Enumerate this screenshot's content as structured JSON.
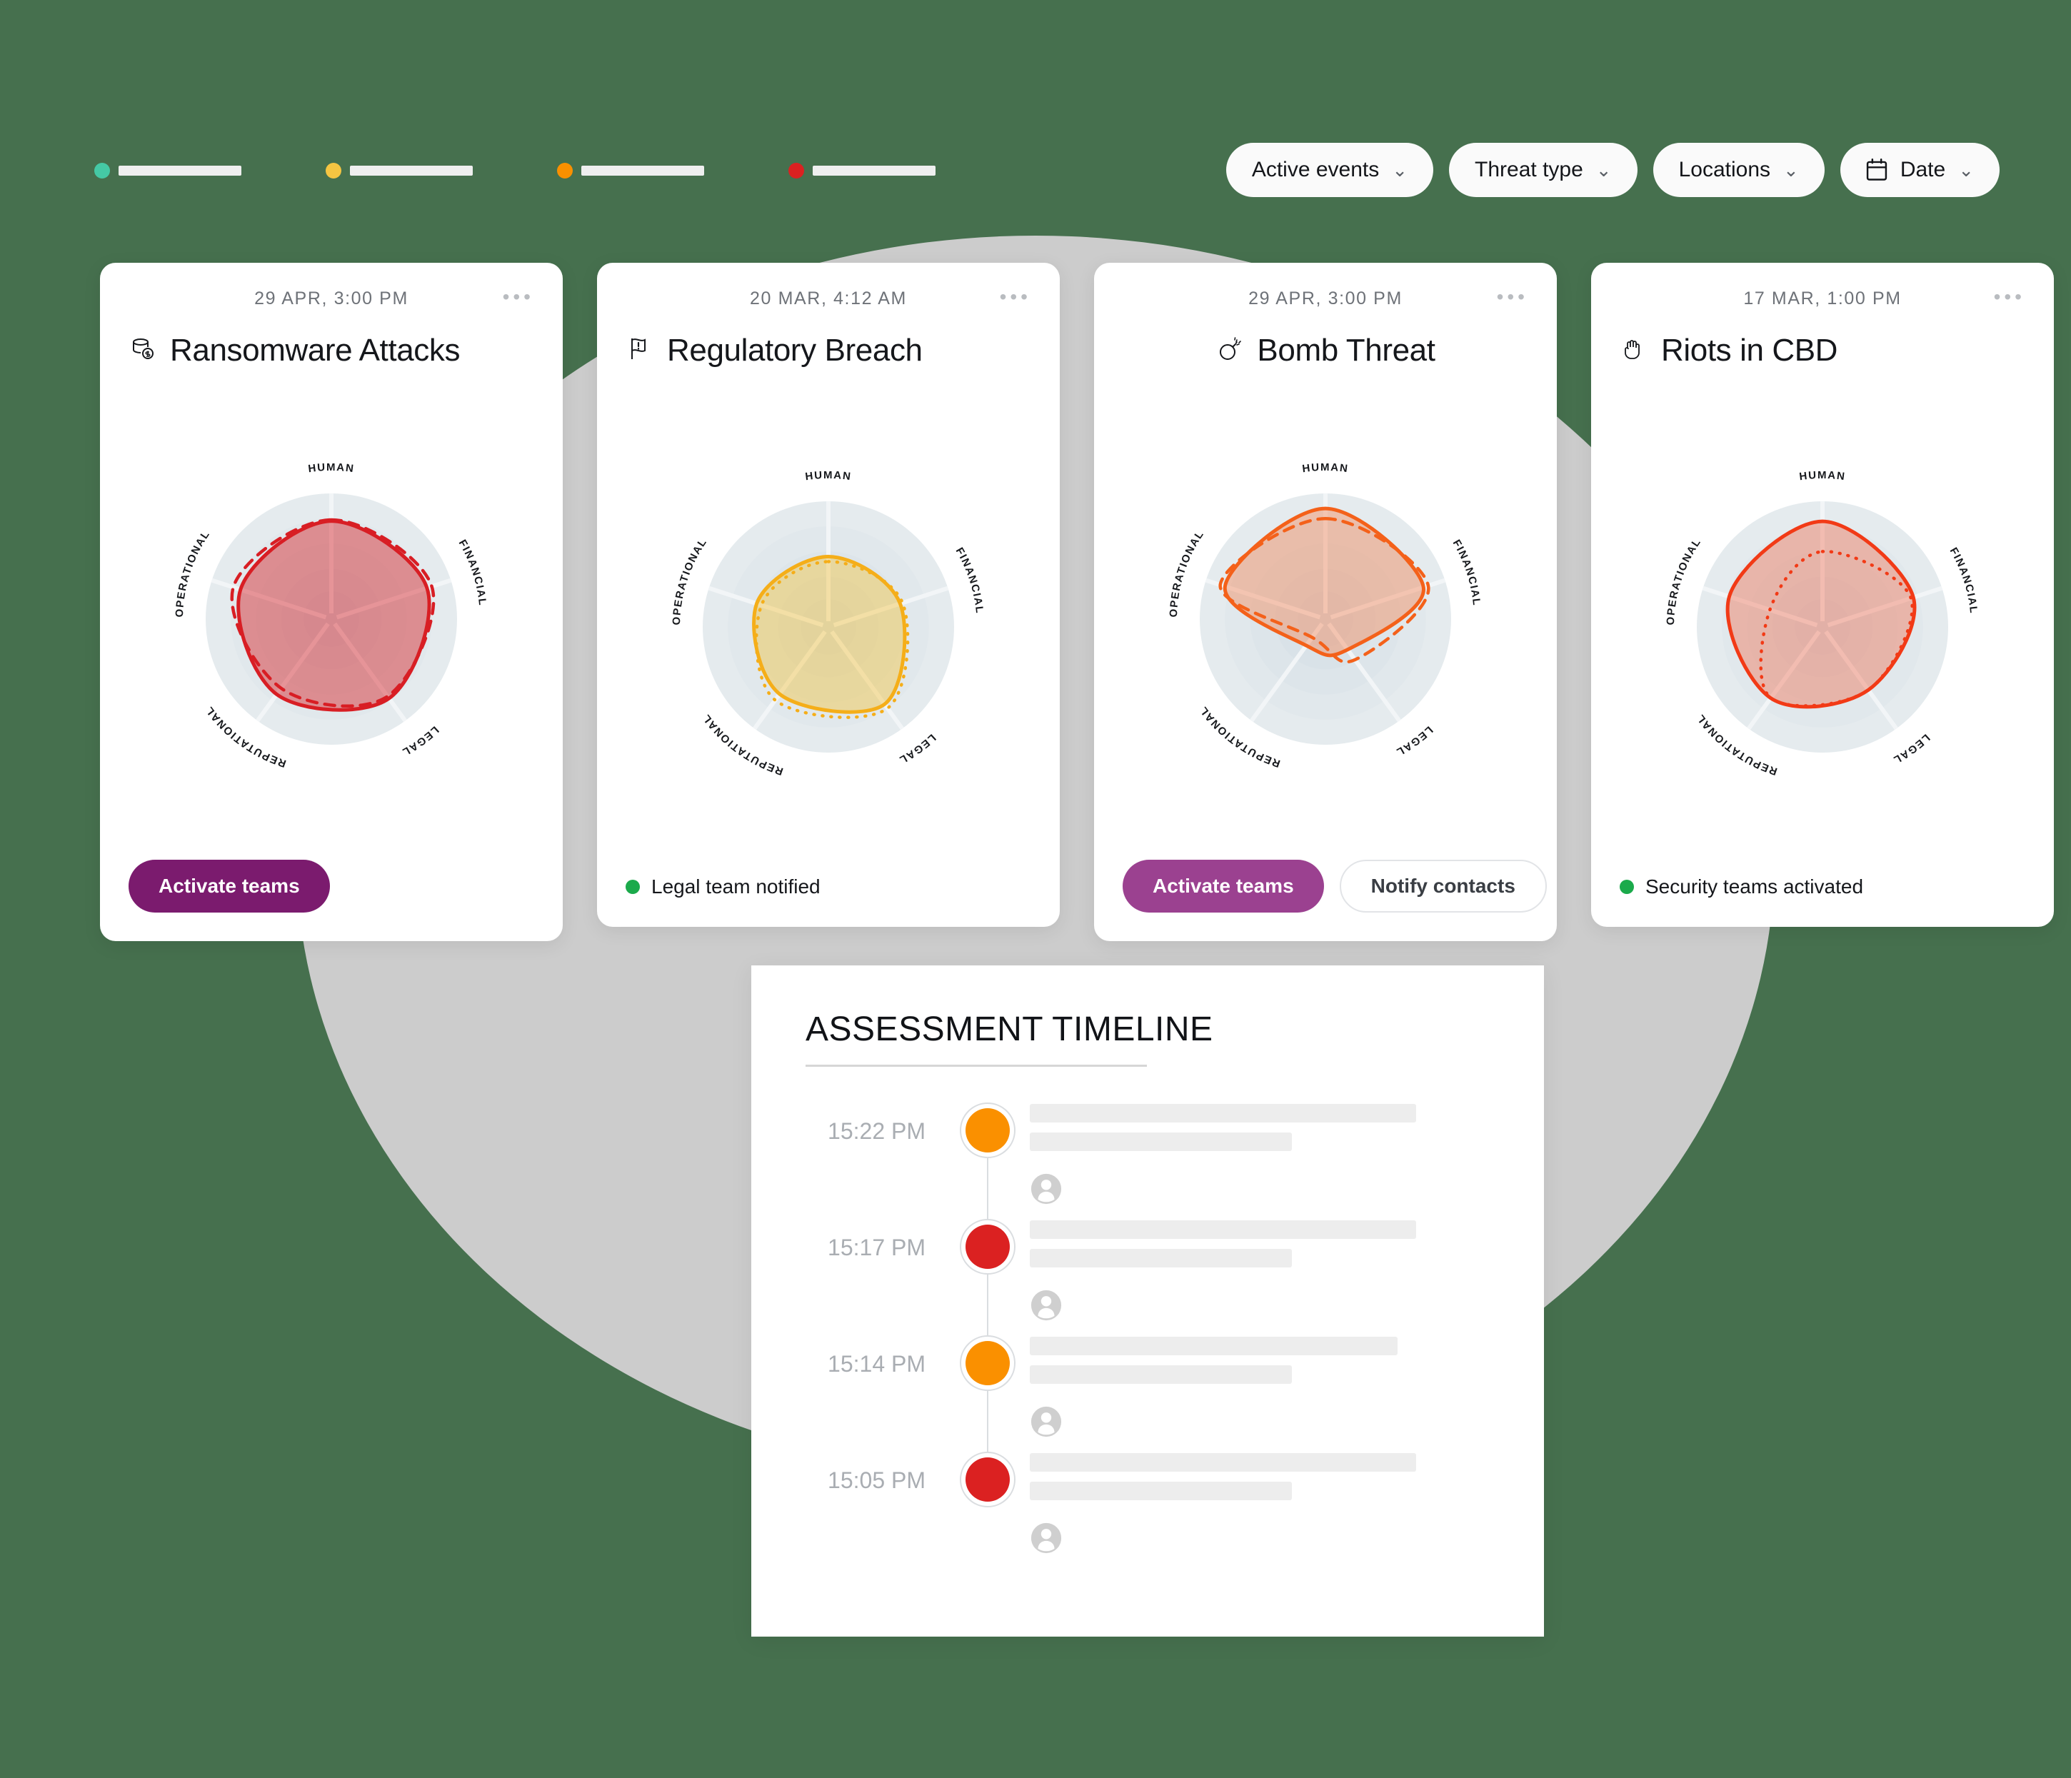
{
  "background_color": "#46704E",
  "legend": {
    "items": [
      {
        "color": "#45C9A5",
        "name": "severity-teal"
      },
      {
        "color": "#F5C542",
        "name": "severity-yellow"
      },
      {
        "color": "#FA9000",
        "name": "severity-orange"
      },
      {
        "color": "#DB2121",
        "name": "severity-red"
      }
    ]
  },
  "filters": [
    {
      "label": "Active events",
      "icon": "chevron-down-icon",
      "has_calendar": false
    },
    {
      "label": "Threat type",
      "icon": "chevron-down-icon",
      "has_calendar": false
    },
    {
      "label": "Locations",
      "icon": "chevron-down-icon",
      "has_calendar": false
    },
    {
      "label": "Date",
      "icon": "calendar-icon",
      "has_calendar": true
    }
  ],
  "cards": [
    {
      "date": "29 APR, 3:00 PM",
      "menu": "• • •",
      "title": "Ransomware Attacks",
      "icon": "database-money-icon",
      "icon_glyph": "⛁",
      "accent": "#D81E24",
      "fill": "#D81E24",
      "status": null,
      "buttons": [
        {
          "label": "Activate teams",
          "style": "primary"
        }
      ]
    },
    {
      "date": "20 MAR, 4:12 AM",
      "menu": "• • •",
      "title": "Regulatory Breach",
      "icon": "flag-alert-icon",
      "icon_glyph": "⚑",
      "accent": "#F5AE19",
      "fill": "#F5C542",
      "status": {
        "label": "Legal team notified",
        "color": "#1BAA4B"
      },
      "buttons": []
    },
    {
      "date": "29 APR, 3:00 PM",
      "menu": "• • •",
      "title": "Bomb Threat",
      "icon": "bomb-icon",
      "icon_glyph": "Ὂ3",
      "accent": "#F4611A",
      "fill": "#F4895A",
      "status": null,
      "buttons": [
        {
          "label": "Activate teams",
          "style": "primary-light"
        },
        {
          "label": "Notify contacts",
          "style": "ghost"
        }
      ]
    },
    {
      "date": "17 MAR, 1:00 PM",
      "menu": "• • •",
      "title": "Riots in CBD",
      "icon": "raised-fist-icon",
      "icon_glyph": "✊",
      "accent": "#F23A16",
      "fill": "#F2785C",
      "status": {
        "label": "Security teams activated",
        "color": "#1BAA4B"
      },
      "buttons": []
    }
  ],
  "timeline": {
    "title": "ASSESSMENT TIMELINE",
    "rows": [
      {
        "time": "15:22 PM",
        "color": "#FA9000",
        "bar1_width": "84%",
        "bar2_width": "57%"
      },
      {
        "time": "15:17 PM",
        "color": "#DB2121",
        "bar1_width": "84%",
        "bar2_width": "57%"
      },
      {
        "time": "15:14 PM",
        "color": "#FA9000",
        "bar1_width": "80%",
        "bar2_width": "57%"
      },
      {
        "time": "15:05 PM",
        "color": "#DB2121",
        "bar1_width": "84%",
        "bar2_width": "57%"
      }
    ]
  },
  "chart_data": [
    {
      "type": "radar",
      "title": "Ransomware Attacks",
      "axes": [
        "HUMAN",
        "FINANCIAL",
        "LEGAL",
        "REPUTATIONAL",
        "OPERATIONAL"
      ],
      "series": [
        {
          "name": "current",
          "style": "solid",
          "values": [
            78,
            80,
            78,
            74,
            76
          ]
        },
        {
          "name": "previous",
          "style": "dashed",
          "values": [
            79,
            84,
            76,
            68,
            82
          ]
        }
      ],
      "range": [
        0,
        100
      ],
      "grid": true,
      "legend": "none"
    },
    {
      "type": "radar",
      "title": "Regulatory Breach",
      "axes": [
        "HUMAN",
        "FINANCIAL",
        "LEGAL",
        "REPUTATIONAL",
        "OPERATIONAL"
      ],
      "series": [
        {
          "name": "current",
          "style": "solid",
          "values": [
            56,
            60,
            76,
            66,
            60
          ]
        },
        {
          "name": "previous",
          "style": "dotted",
          "values": [
            52,
            62,
            80,
            72,
            56
          ]
        }
      ],
      "range": [
        0,
        100
      ],
      "grid": true,
      "legend": "none"
    },
    {
      "type": "radar",
      "title": "Bomb Threat",
      "axes": [
        "HUMAN",
        "FINANCIAL",
        "LEGAL",
        "REPUTATIONAL",
        "OPERATIONAL"
      ],
      "series": [
        {
          "name": "current",
          "style": "solid",
          "values": [
            88,
            82,
            30,
            26,
            84
          ]
        },
        {
          "name": "previous",
          "style": "dashed",
          "values": [
            80,
            86,
            40,
            18,
            88
          ]
        }
      ],
      "range": [
        0,
        100
      ],
      "grid": true,
      "legend": "none"
    },
    {
      "type": "radar",
      "title": "Riots in CBD",
      "axes": [
        "HUMAN",
        "FINANCIAL",
        "LEGAL",
        "REPUTATIONAL",
        "OPERATIONAL"
      ],
      "series": [
        {
          "name": "current",
          "style": "solid",
          "values": [
            84,
            76,
            62,
            70,
            78
          ]
        },
        {
          "name": "previous",
          "style": "dotted",
          "values": [
            60,
            74,
            62,
            70,
            44
          ]
        }
      ],
      "range": [
        0,
        100
      ],
      "grid": true,
      "legend": "none"
    }
  ]
}
